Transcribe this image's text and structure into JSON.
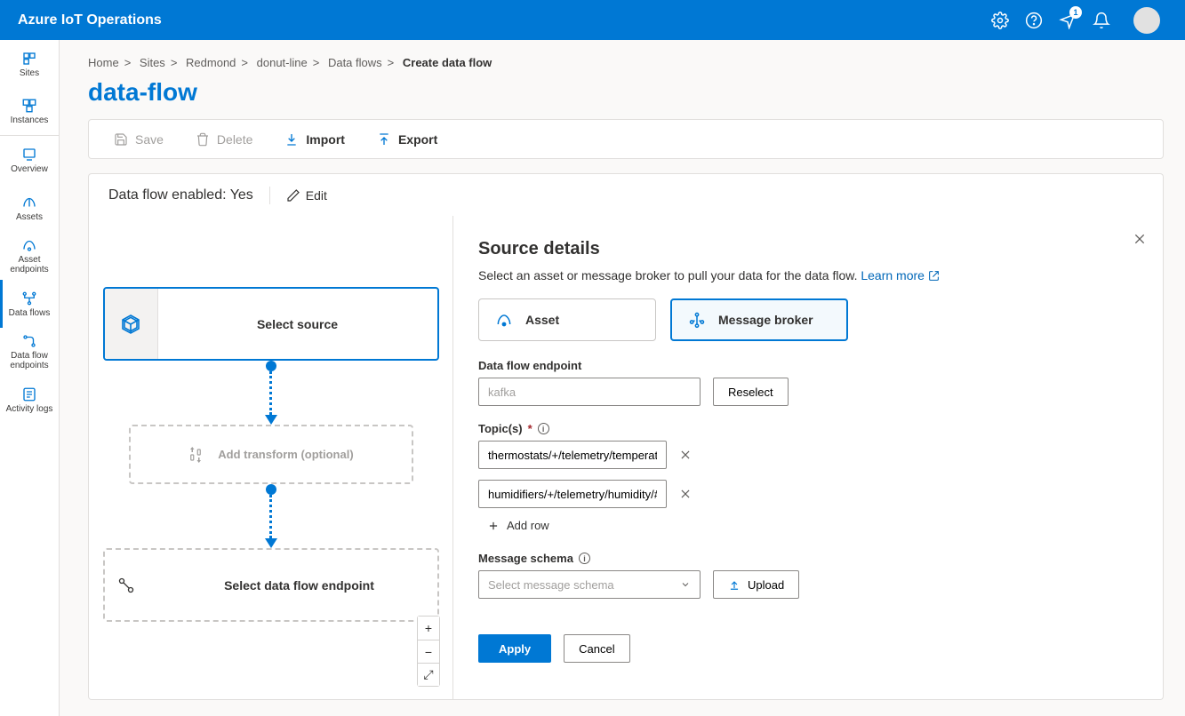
{
  "header": {
    "product": "Azure IoT Operations",
    "notification_count": "1"
  },
  "nav": {
    "items": [
      {
        "label": "Sites"
      },
      {
        "label": "Instances"
      },
      {
        "label": "Overview"
      },
      {
        "label": "Assets"
      },
      {
        "label": "Asset endpoints"
      },
      {
        "label": "Data flows"
      },
      {
        "label": "Data flow endpoints"
      },
      {
        "label": "Activity logs"
      }
    ]
  },
  "breadcrumb": {
    "items": [
      "Home",
      "Sites",
      "Redmond",
      "donut-line",
      "Data flows"
    ],
    "current": "Create data flow"
  },
  "page": {
    "title": "data-flow"
  },
  "toolbar": {
    "save": "Save",
    "delete": "Delete",
    "import": "Import",
    "export": "Export"
  },
  "status": {
    "enabled_label": "Data flow enabled:",
    "enabled_value": "Yes",
    "edit": "Edit"
  },
  "diagram": {
    "source": "Select source",
    "transform": "Add transform (optional)",
    "dest": "Select data flow endpoint"
  },
  "details": {
    "title": "Source details",
    "subtitle": "Select an asset or message broker to pull your data for the data flow.",
    "learn_more": "Learn more",
    "asset_label": "Asset",
    "broker_label": "Message broker",
    "endpoint_label": "Data flow endpoint",
    "endpoint_placeholder": "kafka",
    "reselect": "Reselect",
    "topics_label": "Topic(s)",
    "topics": [
      "thermostats/+/telemetry/temperature/#",
      "humidifiers/+/telemetry/humidity/#"
    ],
    "add_row": "Add row",
    "schema_label": "Message schema",
    "schema_placeholder": "Select message schema",
    "upload": "Upload",
    "apply": "Apply",
    "cancel": "Cancel"
  }
}
